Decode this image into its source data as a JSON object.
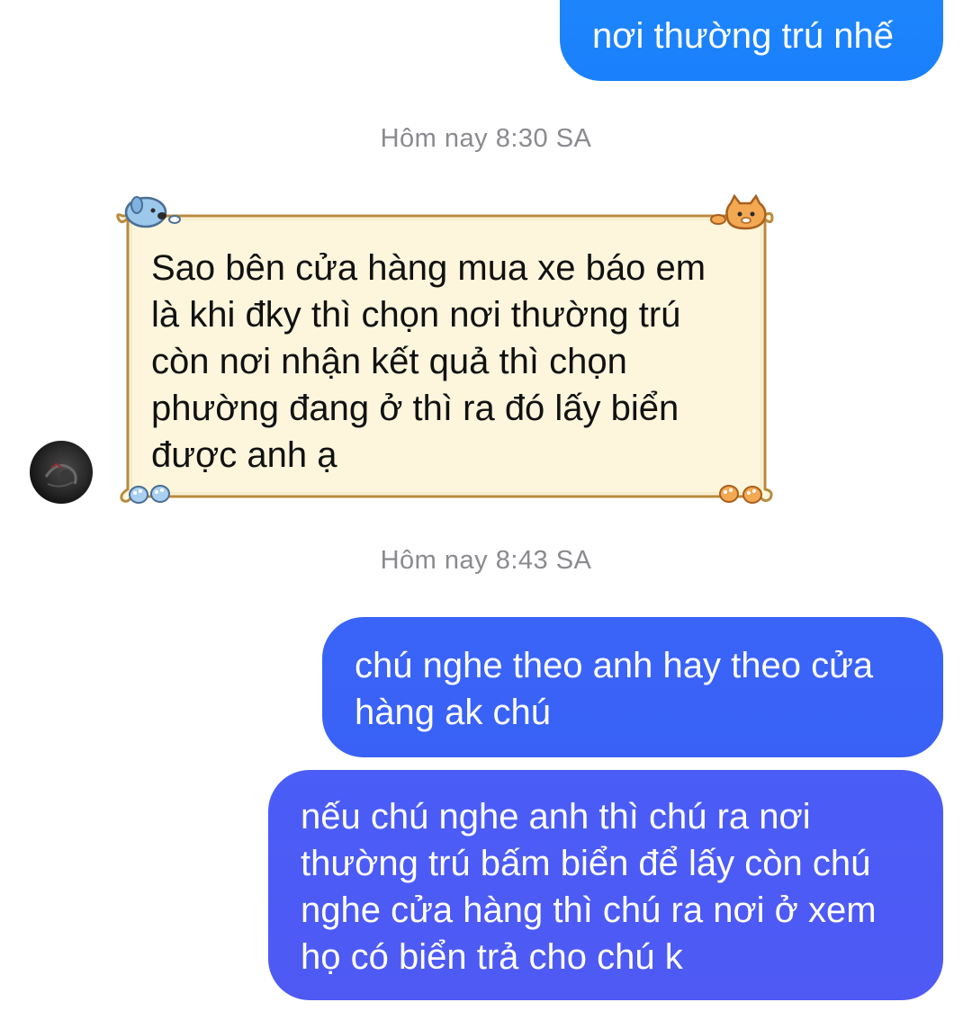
{
  "messages": {
    "out1": {
      "text": "nơi thường trú nhế"
    },
    "timestamp1": "Hôm nay 8:30 SA",
    "in1": {
      "lines": [
        "Sao bên cửa hàng mua xe báo em",
        "là khi đky thì chọn nơi thường trú",
        "còn nơi nhận kết quả thì chọn",
        "phường đang ở thì ra đó lấy biển",
        "được anh ạ"
      ]
    },
    "timestamp2": "Hôm nay 8:43 SA",
    "out2": {
      "lines": [
        "chú nghe theo anh hay theo cửa",
        "hàng ak chú"
      ]
    },
    "out3": {
      "lines": [
        "nếu chú nghe anh thì chú ra nơi",
        "thường trú bấm biển để lấy còn chú",
        "nghe cửa hàng thì chú ra nơi ở xem",
        "họ có biển trả cho chú k"
      ]
    }
  },
  "colors": {
    "outgoing_top": "#1a80fc",
    "outgoing_mid": "#3a63f7",
    "outgoing_bottom": "#4f59f4",
    "card_fill": "#fdf6dc",
    "card_border": "#b98a3e",
    "timestamp": "#8a8a8f"
  },
  "icons": {
    "avatar": "contact-avatar",
    "card_top_left": "blue-puppy-icon",
    "card_top_right": "orange-cat-icon",
    "card_bottom_left": "blue-paw-icon",
    "card_bottom_right": "orange-paw-icon"
  }
}
